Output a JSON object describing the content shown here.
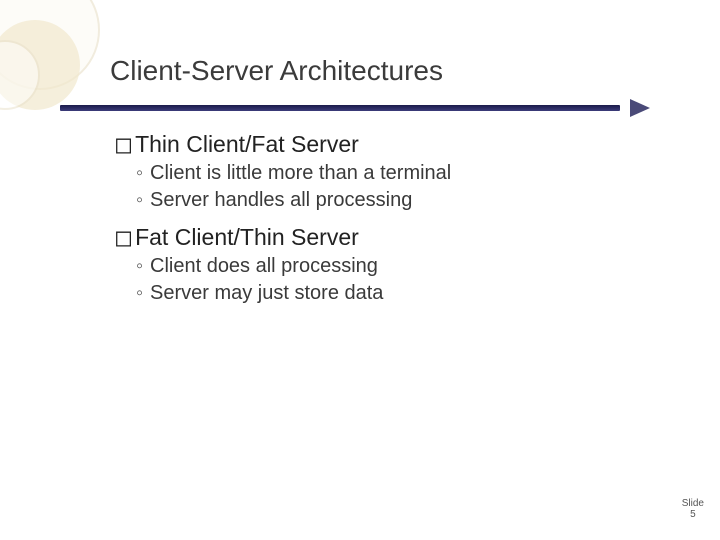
{
  "title": "Client-Server Architectures",
  "section1": {
    "heading": "Thin Client/Fat Server",
    "points": [
      "Client is little more than a terminal",
      "Server handles all processing"
    ]
  },
  "section2": {
    "heading": "Fat Client/Thin Server",
    "points": [
      "Client does all processing",
      "Server may just store data"
    ]
  },
  "box_char": "◻",
  "sub_bullet": "◦",
  "footer": {
    "label": "Slide",
    "number": "5"
  }
}
